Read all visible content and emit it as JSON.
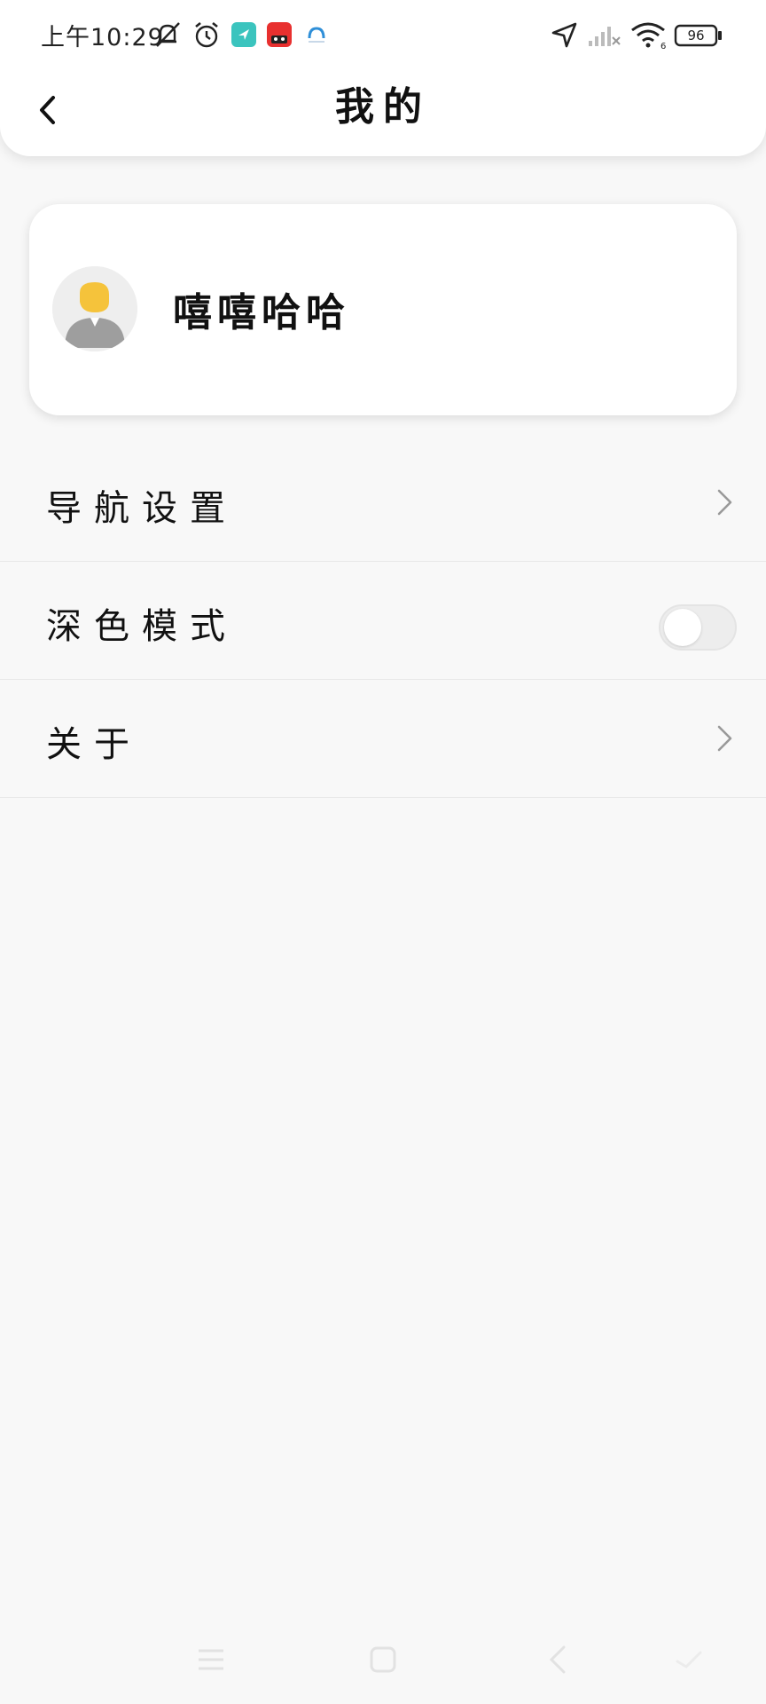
{
  "status_bar": {
    "time": "上午10:29",
    "icons": [
      "mute-icon",
      "alarm-icon",
      "location-app-icon",
      "tmall-app-icon",
      "browser-app-icon",
      "navigation-arrow-icon",
      "signal-icon",
      "wifi-icon",
      "battery-icon"
    ],
    "battery_level": "96"
  },
  "header": {
    "title": "我的",
    "back_icon": "chevron-left-icon"
  },
  "profile": {
    "username": "嘻嘻哈哈",
    "avatar_icon": "default-avatar-icon"
  },
  "settings": {
    "items": [
      {
        "label": "导航设置",
        "control": "chevron"
      },
      {
        "label": "深色模式",
        "control": "toggle",
        "toggle_on": false
      },
      {
        "label": "关于",
        "control": "chevron"
      }
    ]
  },
  "nav_bar": {
    "icons": [
      "menu-icon",
      "home-icon",
      "back-icon",
      "assistant-icon"
    ]
  },
  "colors": {
    "background": "#f8f8f8",
    "card": "#ffffff",
    "text": "#111111",
    "chevron": "#999999",
    "avatar_head": "#f5c33b",
    "avatar_body": "#9e9e9e"
  }
}
